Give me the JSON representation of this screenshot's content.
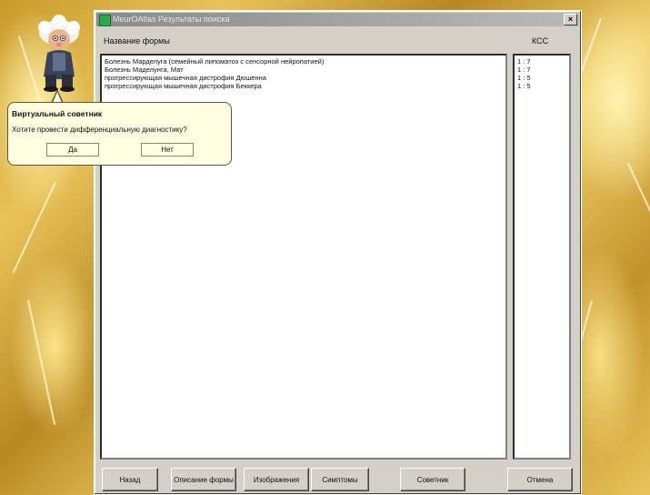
{
  "window": {
    "title": "MeurOAtlas  Результаты поиска",
    "close_label": "×"
  },
  "labels": {
    "form_name": "Название формы",
    "score": "КСС"
  },
  "results": [
    {
      "name": "Болезнь Марделуга (семейный липоматоз с сенсорной нейропатией)",
      "score": "1 : 7"
    },
    {
      "name": "Болезнь Маделунга, Мат",
      "score": "1 : 7"
    },
    {
      "name": "прогрессирующая мышечная дистрофия Дюшенна",
      "score": "1 : 5"
    },
    {
      "name": "прогрессирующая мышечная дистрофия Беккера",
      "score": "1 : 5"
    }
  ],
  "buttons": {
    "back": "Назад",
    "description": "Описание формы",
    "images": "Изображения",
    "symptoms": "Симптомы",
    "advice": "Советник",
    "cancel": "Отмена"
  },
  "assistant": {
    "title": "Виртуальный советник",
    "question": "Хотите провести дифференциальную диагностику?",
    "yes": "Да",
    "no": "Нет"
  }
}
